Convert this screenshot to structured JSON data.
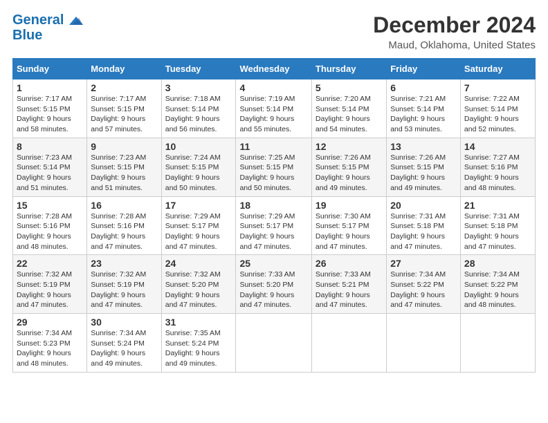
{
  "header": {
    "logo_line1": "General",
    "logo_line2": "Blue",
    "title": "December 2024",
    "subtitle": "Maud, Oklahoma, United States"
  },
  "days_of_week": [
    "Sunday",
    "Monday",
    "Tuesday",
    "Wednesday",
    "Thursday",
    "Friday",
    "Saturday"
  ],
  "weeks": [
    [
      {
        "day": "1",
        "rise": "Sunrise: 7:17 AM",
        "set": "Sunset: 5:15 PM",
        "daylight": "Daylight: 9 hours and 58 minutes."
      },
      {
        "day": "2",
        "rise": "Sunrise: 7:17 AM",
        "set": "Sunset: 5:15 PM",
        "daylight": "Daylight: 9 hours and 57 minutes."
      },
      {
        "day": "3",
        "rise": "Sunrise: 7:18 AM",
        "set": "Sunset: 5:14 PM",
        "daylight": "Daylight: 9 hours and 56 minutes."
      },
      {
        "day": "4",
        "rise": "Sunrise: 7:19 AM",
        "set": "Sunset: 5:14 PM",
        "daylight": "Daylight: 9 hours and 55 minutes."
      },
      {
        "day": "5",
        "rise": "Sunrise: 7:20 AM",
        "set": "Sunset: 5:14 PM",
        "daylight": "Daylight: 9 hours and 54 minutes."
      },
      {
        "day": "6",
        "rise": "Sunrise: 7:21 AM",
        "set": "Sunset: 5:14 PM",
        "daylight": "Daylight: 9 hours and 53 minutes."
      },
      {
        "day": "7",
        "rise": "Sunrise: 7:22 AM",
        "set": "Sunset: 5:14 PM",
        "daylight": "Daylight: 9 hours and 52 minutes."
      }
    ],
    [
      {
        "day": "8",
        "rise": "Sunrise: 7:23 AM",
        "set": "Sunset: 5:14 PM",
        "daylight": "Daylight: 9 hours and 51 minutes."
      },
      {
        "day": "9",
        "rise": "Sunrise: 7:23 AM",
        "set": "Sunset: 5:15 PM",
        "daylight": "Daylight: 9 hours and 51 minutes."
      },
      {
        "day": "10",
        "rise": "Sunrise: 7:24 AM",
        "set": "Sunset: 5:15 PM",
        "daylight": "Daylight: 9 hours and 50 minutes."
      },
      {
        "day": "11",
        "rise": "Sunrise: 7:25 AM",
        "set": "Sunset: 5:15 PM",
        "daylight": "Daylight: 9 hours and 50 minutes."
      },
      {
        "day": "12",
        "rise": "Sunrise: 7:26 AM",
        "set": "Sunset: 5:15 PM",
        "daylight": "Daylight: 9 hours and 49 minutes."
      },
      {
        "day": "13",
        "rise": "Sunrise: 7:26 AM",
        "set": "Sunset: 5:15 PM",
        "daylight": "Daylight: 9 hours and 49 minutes."
      },
      {
        "day": "14",
        "rise": "Sunrise: 7:27 AM",
        "set": "Sunset: 5:16 PM",
        "daylight": "Daylight: 9 hours and 48 minutes."
      }
    ],
    [
      {
        "day": "15",
        "rise": "Sunrise: 7:28 AM",
        "set": "Sunset: 5:16 PM",
        "daylight": "Daylight: 9 hours and 48 minutes."
      },
      {
        "day": "16",
        "rise": "Sunrise: 7:28 AM",
        "set": "Sunset: 5:16 PM",
        "daylight": "Daylight: 9 hours and 47 minutes."
      },
      {
        "day": "17",
        "rise": "Sunrise: 7:29 AM",
        "set": "Sunset: 5:17 PM",
        "daylight": "Daylight: 9 hours and 47 minutes."
      },
      {
        "day": "18",
        "rise": "Sunrise: 7:29 AM",
        "set": "Sunset: 5:17 PM",
        "daylight": "Daylight: 9 hours and 47 minutes."
      },
      {
        "day": "19",
        "rise": "Sunrise: 7:30 AM",
        "set": "Sunset: 5:17 PM",
        "daylight": "Daylight: 9 hours and 47 minutes."
      },
      {
        "day": "20",
        "rise": "Sunrise: 7:31 AM",
        "set": "Sunset: 5:18 PM",
        "daylight": "Daylight: 9 hours and 47 minutes."
      },
      {
        "day": "21",
        "rise": "Sunrise: 7:31 AM",
        "set": "Sunset: 5:18 PM",
        "daylight": "Daylight: 9 hours and 47 minutes."
      }
    ],
    [
      {
        "day": "22",
        "rise": "Sunrise: 7:32 AM",
        "set": "Sunset: 5:19 PM",
        "daylight": "Daylight: 9 hours and 47 minutes."
      },
      {
        "day": "23",
        "rise": "Sunrise: 7:32 AM",
        "set": "Sunset: 5:19 PM",
        "daylight": "Daylight: 9 hours and 47 minutes."
      },
      {
        "day": "24",
        "rise": "Sunrise: 7:32 AM",
        "set": "Sunset: 5:20 PM",
        "daylight": "Daylight: 9 hours and 47 minutes."
      },
      {
        "day": "25",
        "rise": "Sunrise: 7:33 AM",
        "set": "Sunset: 5:20 PM",
        "daylight": "Daylight: 9 hours and 47 minutes."
      },
      {
        "day": "26",
        "rise": "Sunrise: 7:33 AM",
        "set": "Sunset: 5:21 PM",
        "daylight": "Daylight: 9 hours and 47 minutes."
      },
      {
        "day": "27",
        "rise": "Sunrise: 7:34 AM",
        "set": "Sunset: 5:22 PM",
        "daylight": "Daylight: 9 hours and 47 minutes."
      },
      {
        "day": "28",
        "rise": "Sunrise: 7:34 AM",
        "set": "Sunset: 5:22 PM",
        "daylight": "Daylight: 9 hours and 48 minutes."
      }
    ],
    [
      {
        "day": "29",
        "rise": "Sunrise: 7:34 AM",
        "set": "Sunset: 5:23 PM",
        "daylight": "Daylight: 9 hours and 48 minutes."
      },
      {
        "day": "30",
        "rise": "Sunrise: 7:34 AM",
        "set": "Sunset: 5:24 PM",
        "daylight": "Daylight: 9 hours and 49 minutes."
      },
      {
        "day": "31",
        "rise": "Sunrise: 7:35 AM",
        "set": "Sunset: 5:24 PM",
        "daylight": "Daylight: 9 hours and 49 minutes."
      },
      null,
      null,
      null,
      null
    ]
  ]
}
